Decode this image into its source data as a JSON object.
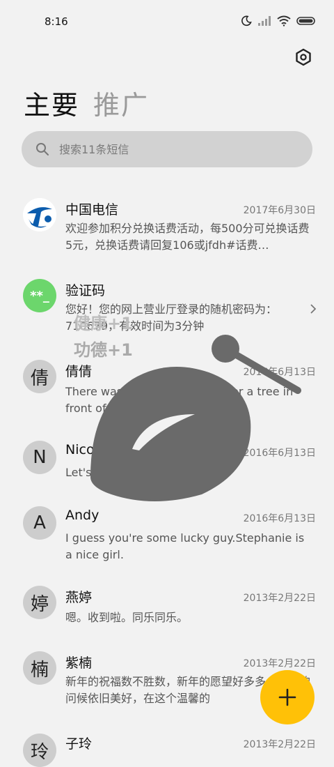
{
  "status": {
    "time": "8:16"
  },
  "tabs": {
    "primary": "主要",
    "promo": "推广"
  },
  "search": {
    "placeholder": "搜索11条短信"
  },
  "messages": [
    {
      "name": "中国电信",
      "date": "2017年6月30日",
      "text": "欢迎参加积分兑换话费活动，每500分可兑换话费5元，兑换话费请回复106或jfdh#话费…",
      "avatar": "telecom-logo"
    },
    {
      "name": "验证码",
      "date": "",
      "text": "您好！您的网上营业厅登录的随机密码为：710679，有效时间为3分钟",
      "avatar": "**_"
    },
    {
      "name": "倩倩",
      "date": "2016年6月13日",
      "text": "There was a table set out under a tree in front of the hous",
      "avatar": "倩"
    },
    {
      "name": "Nicole",
      "date": "2016年6月13日",
      "text": "Let's eat out,shall we?",
      "avatar": "N"
    },
    {
      "name": "Andy",
      "date": "2016年6月13日",
      "text": "I guess you're some lucky guy.Stephanie is a nice girl.",
      "avatar": "A"
    },
    {
      "name": "燕婷",
      "date": "2013年2月22日",
      "text": "嗯。收到啦。同乐同乐。",
      "avatar": "婷"
    },
    {
      "name": "紫楠",
      "date": "2013年2月22日",
      "text": "新年的祝福数不胜数，新年的愿望好多多，新年的问候依旧美好，在这个温馨的",
      "avatar": "楠"
    },
    {
      "name": "子玲",
      "date": "2013年2月22日",
      "text": "",
      "avatar": "玲"
    }
  ],
  "overlay": {
    "line1": "健康+1",
    "line2": "功德+1"
  },
  "fab": {
    "label": "+"
  }
}
